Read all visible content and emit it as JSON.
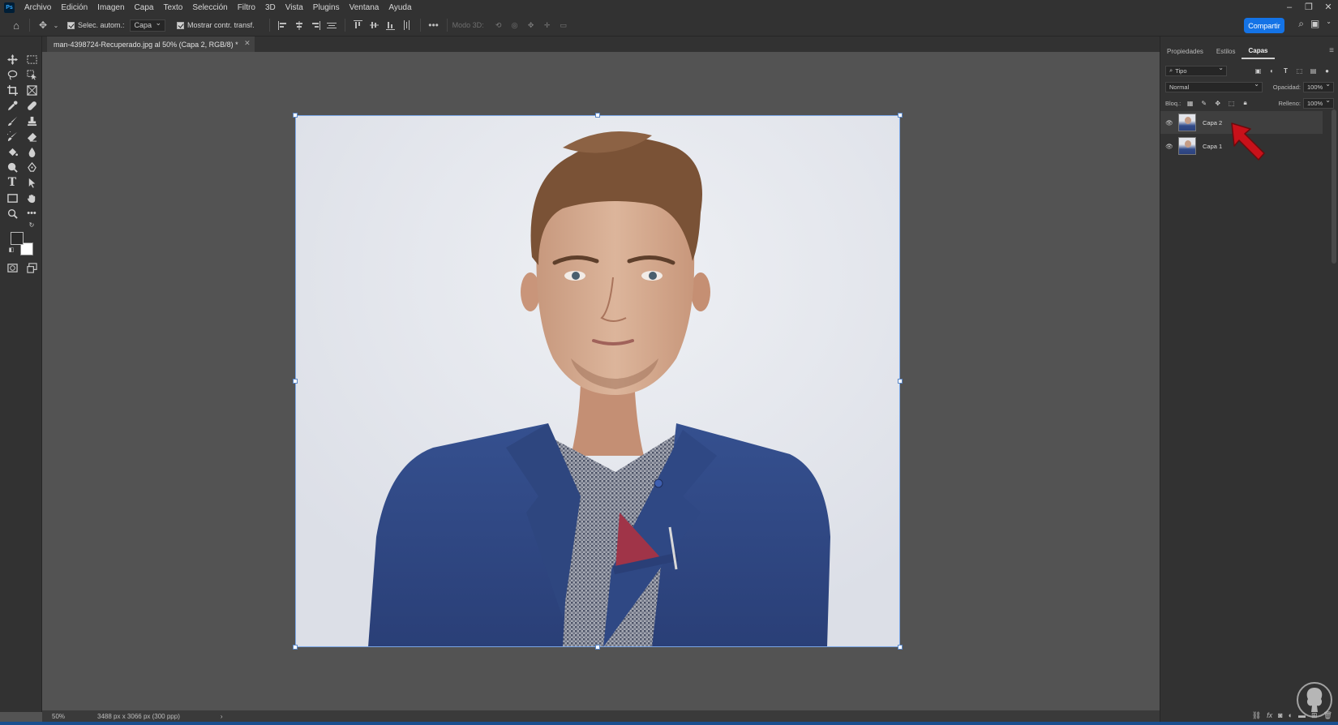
{
  "menubar": {
    "items": [
      "Archivo",
      "Edición",
      "Imagen",
      "Capa",
      "Texto",
      "Selección",
      "Filtro",
      "3D",
      "Vista",
      "Plugins",
      "Ventana",
      "Ayuda"
    ]
  },
  "options": {
    "auto_select_label": "Selec. autom.:",
    "auto_select_value": "Capa",
    "show_transform_label": "Mostrar contr. transf.",
    "mode3d_label": "Modo 3D:",
    "share_label": "Compartir"
  },
  "document": {
    "tab_title": "man-4398724-Recuperado.jpg al 50% (Capa 2, RGB/8) *"
  },
  "status": {
    "zoom": "50%",
    "doc_info": "3488 px x 3066 px (300 ppp)",
    "arrow": "›"
  },
  "panel": {
    "tabs": [
      "Propiedades",
      "Estilos",
      "Capas"
    ],
    "active_tab": "Capas",
    "filter_label": "Tipo",
    "blend_mode": "Normal",
    "opacity_label": "Opacidad:",
    "opacity_value": "100%",
    "lock_label": "Bloq.:",
    "fill_label": "Relleno:",
    "fill_value": "100%",
    "layers": [
      {
        "name": "Capa 2",
        "selected": true
      },
      {
        "name": "Capa 1",
        "selected": false
      }
    ]
  },
  "colors": {
    "accent": "#1473e6",
    "frame": "#7aa6e6",
    "arrow": "#c8111a"
  }
}
